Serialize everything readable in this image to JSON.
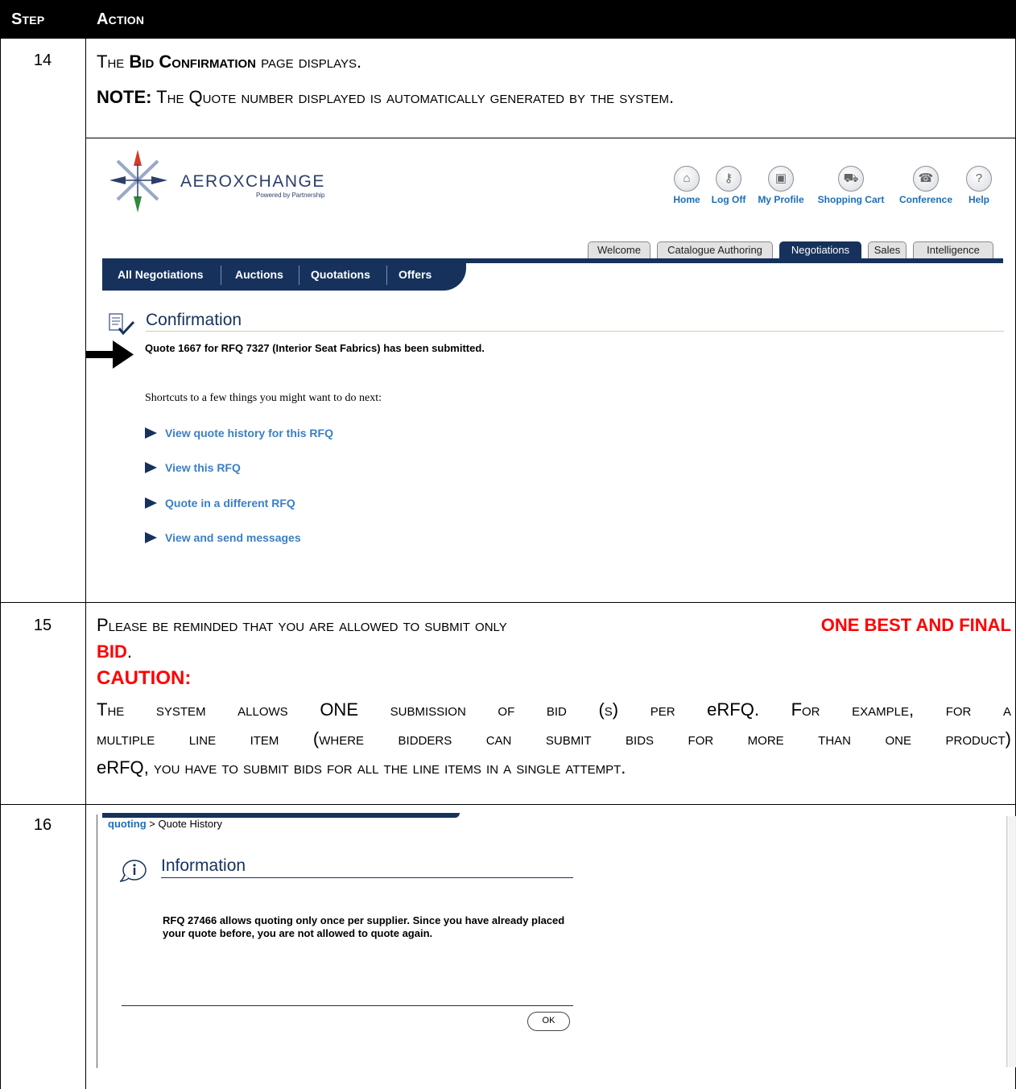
{
  "header": {
    "step": "Step",
    "action": "Action"
  },
  "step14": {
    "num": "14",
    "line1_pre": "The ",
    "line1_bold": "Bid Confirmation",
    "line1_post": " page displays.",
    "note_label": "NOTE:",
    "note_text": " The Quote number displayed is automatically generated by the system."
  },
  "screen1": {
    "logo_name": "AEROXCHANGE",
    "logo_tagline": "Powered by Partnership",
    "top_nav": [
      {
        "label": "Home",
        "icon": "home-icon",
        "glyph": "⌂"
      },
      {
        "label": "Log Off",
        "icon": "keys-icon",
        "glyph": "⚷"
      },
      {
        "label": "My Profile",
        "icon": "briefcase-icon",
        "glyph": "▣"
      },
      {
        "label": "Shopping Cart",
        "icon": "cart-icon",
        "glyph": "⛟"
      },
      {
        "label": "Conference",
        "icon": "conference-icon",
        "glyph": "☎"
      },
      {
        "label": "Help",
        "icon": "help-icon",
        "glyph": "?"
      }
    ],
    "main_tabs": [
      "Welcome",
      "Catalogue Authoring",
      "Negotiations",
      "Sales",
      "Intelligence"
    ],
    "active_main_tab": "Negotiations",
    "sub_tabs": [
      "All Negotiations",
      "Auctions",
      "Quotations",
      "Offers"
    ],
    "page_title": "Confirmation",
    "message": "Quote 1667 for RFQ 7327 (Interior Seat Fabrics) has been submitted.",
    "shortcuts_intro": "Shortcuts to a few things you might want to do next:",
    "shortcuts": [
      "View quote history for this RFQ",
      "View this RFQ",
      "Quote in a different RFQ",
      "View and send messages"
    ]
  },
  "step15": {
    "num": "15",
    "line1": "Please be reminded that you are allowed to submit only ",
    "emph": "ONE BEST AND FINAL",
    "emph2": "BID",
    "emph2_tail": ".",
    "caution": "CAUTION:",
    "body_1": "The system allows ",
    "body_one": "ONE",
    "body_2": " submission of bid (s) per ",
    "body_erfq": "eRFQ",
    "body_3": ". For example, for a",
    "body_line2": "multiple line item (where bidders can submit bids for more than one product)",
    "body_line3_erfq": "eRFQ",
    "body_line3": ", you have to submit bids for all the line items in a single attempt."
  },
  "step16": {
    "num": "16"
  },
  "screen2": {
    "breadcrumb_link": "quoting",
    "breadcrumb_sep": ">",
    "breadcrumb_current": "Quote History",
    "info_title": "Information",
    "info_message": "RFQ 27466 allows quoting only once per supplier. Since you have already placed your quote before, you are not allowed to quote again.",
    "ok_label": "OK"
  },
  "colors": {
    "nav_navy": "#16325c",
    "link_blue": "#1d6eb7",
    "shortcut_blue": "#3a7fc4",
    "warning_red": "#ff0000"
  }
}
